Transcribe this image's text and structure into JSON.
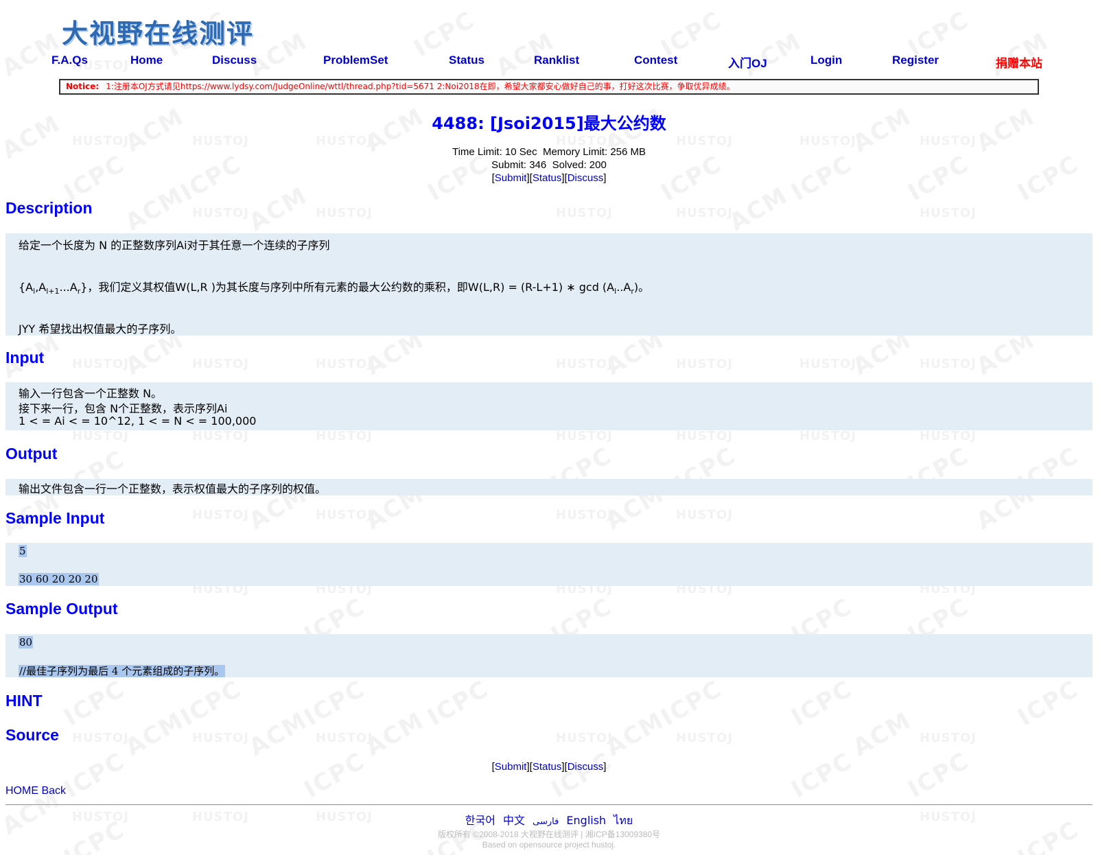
{
  "site": {
    "logo_text": "大视野在线测评"
  },
  "nav": {
    "faq": "F.A.Qs",
    "home": "Home",
    "discuss": "Discuss",
    "problemset": "ProblemSet",
    "status": "Status",
    "ranklist": "Ranklist",
    "contest": "Contest",
    "intro": "入门OJ",
    "login": "Login",
    "register": "Register",
    "donate": "捐赠本站"
  },
  "notice": {
    "label": "Notice:",
    "text": "1:注册本OJ方式请见https://www.lydsy.com/JudgeOnline/wttl/thread.php?tid=5671 2:Noi2018在即，希望大家都安心做好自己的事，打好这次比赛，争取优异成绩。"
  },
  "problem": {
    "title": "4488: [Jsoi2015]最大公约数",
    "time_limit_label": "Time Limit:",
    "time_limit": "10 Sec",
    "memory_limit_label": "Memory Limit:",
    "memory_limit": "256 MB",
    "submit_label": "Submit:",
    "submit_count": "346",
    "solved_label": "Solved:",
    "solved_count": "200"
  },
  "links": {
    "submit": "Submit",
    "status": "Status",
    "discuss": "Discuss"
  },
  "sections": {
    "description": "Description",
    "input": "Input",
    "output": "Output",
    "sample_input": "Sample Input",
    "sample_output": "Sample Output",
    "hint": "HINT",
    "source": "Source"
  },
  "description": {
    "line1": "给定一个长度为 N 的正整数序列Ai对于其任意一个连续的子序列",
    "formula_set_open": "{A",
    "sub_l": "l",
    "comma_a": ",A",
    "sub_l1": "l+1",
    "dots_a": "...A",
    "sub_r": "r",
    "formula_set_close": "}",
    "formula_text": "，我们定义其权值W(L,R )为其长度与序列中所有元素的最大公约数的乘积，即W(L,R) = (R-L+1) ∗ gcd (A",
    "formula_mid": "..A",
    "formula_end": ")。",
    "line3": "JYY 希望找出权值最大的子序列。"
  },
  "input_text": {
    "line1": "输入一行包含一个正整数 N。",
    "line2": "接下来一行，包含 N个正整数，表示序列Ai",
    "line3": "1 < =  Ai < =  10^12, 1 < =  N < =  100,000"
  },
  "output_text": {
    "line1": "输出文件包含一行一个正整数，表示权值最大的子序列的权值。"
  },
  "sample_input": {
    "line1": "5",
    "line2": "30 60 20 20 20"
  },
  "sample_output": {
    "line1": "80",
    "line2": "//最佳子序列为最后 4 个元素组成的子序列。"
  },
  "bottom": {
    "home": "HOME",
    "back": "Back"
  },
  "languages": [
    "한국어",
    "中文",
    "فارسی",
    "English",
    "ไทย"
  ],
  "footer": {
    "copyright": "版权所有 ©2008-2018 大视野在线测评 | 湘ICP备13009380号",
    "based_on": "Based on opensource project hustoj."
  },
  "colors": {
    "section_bg": "#e3edf5",
    "heading_blue": "#0000ff",
    "link_blue": "#0000cc",
    "donate_red": "#ff0000",
    "notice_red": "#ff0000"
  }
}
